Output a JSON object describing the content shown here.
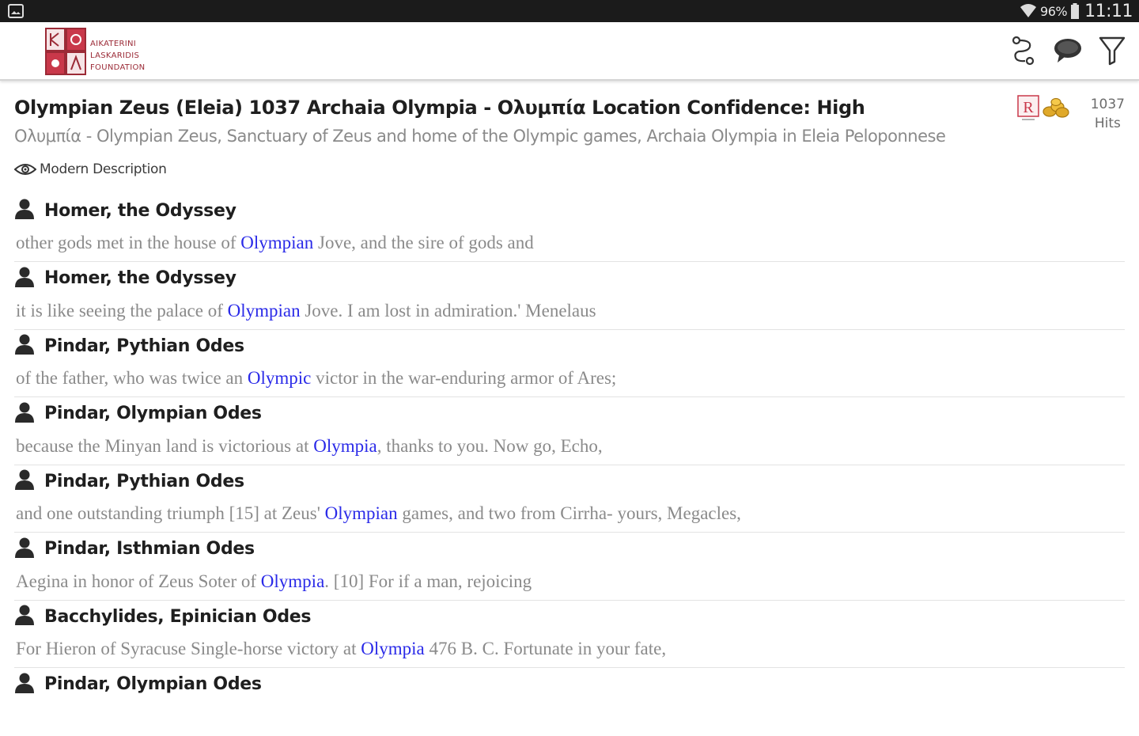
{
  "status_bar": {
    "battery": "96%",
    "time": "11:11"
  },
  "app_bar": {
    "logo_lines": [
      "AIKATERINI",
      "LASKARIDIS",
      "FOUNDATION"
    ]
  },
  "place": {
    "title": "Olympian Zeus (Eleia) 1037 Archaia Olympia - Ολυμπία Location Confidence: High",
    "subtitle": "Ολυμπία - Olympian Zeus, Sanctuary of Zeus and home of the Olympic games, Archaia Olympia in Eleia Peloponnese",
    "hits_count": "1037",
    "hits_label": "Hits",
    "modern_description_label": "Modern Description"
  },
  "results": [
    {
      "title": "Homer, the Odyssey",
      "before": "other gods met in the house of ",
      "highlight": "Olympian",
      "after": " Jove, and the sire of gods and"
    },
    {
      "title": "Homer, the Odyssey",
      "before": "it is like seeing the palace of ",
      "highlight": "Olympian",
      "after": " Jove. I am lost in admiration.' Menelaus"
    },
    {
      "title": "Pindar, Pythian Odes",
      "before": "of the father, who was twice an ",
      "highlight": "Olympic",
      "after": " victor in the war-enduring armor of Ares;"
    },
    {
      "title": "Pindar, Olympian Odes",
      "before": "because the Minyan land is victorious at ",
      "highlight": "Olympia",
      "after": ", thanks to you. Now go, Echo,"
    },
    {
      "title": "Pindar, Pythian Odes",
      "before": "and one outstanding triumph [15] at Zeus' ",
      "highlight": "Olympian",
      "after": " games, and two from Cirrha- yours, Megacles,"
    },
    {
      "title": "Pindar, Isthmian Odes",
      "before": "Aegina in honor of Zeus Soter of ",
      "highlight": "Olympia",
      "after": ". [10] For if a man, rejoicing"
    },
    {
      "title": "Bacchylides, Epinician Odes",
      "before": "For Hieron of Syracuse Single-horse victory at ",
      "highlight": "Olympia",
      "after": " 476 B. C. Fortunate in your fate,"
    },
    {
      "title": "Pindar, Olympian Odes",
      "before": "",
      "highlight": "",
      "after": ""
    }
  ],
  "colors": {
    "highlight": "#2a2ae8",
    "quote_text": "#8a8a8a",
    "logo_red": "#9b2a36",
    "coins": "#e0a92a"
  },
  "icons": {
    "route": "route-icon",
    "chat": "chat-bubble-icon",
    "filter": "filter-icon",
    "person": "person-icon",
    "eye": "eye-icon",
    "r_badge": "r-badge-icon",
    "coins": "coins-icon"
  }
}
